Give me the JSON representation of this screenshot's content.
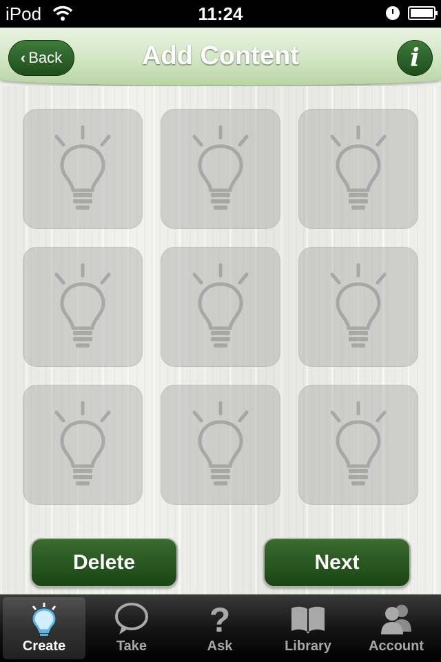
{
  "status_bar": {
    "carrier": "iPod",
    "time": "11:24"
  },
  "nav": {
    "back_label": "Back",
    "title": "Add Content",
    "info_label": "i"
  },
  "tiles": [
    {
      "icon": "lightbulb-icon"
    },
    {
      "icon": "lightbulb-icon"
    },
    {
      "icon": "lightbulb-icon"
    },
    {
      "icon": "lightbulb-icon"
    },
    {
      "icon": "lightbulb-icon"
    },
    {
      "icon": "lightbulb-icon"
    },
    {
      "icon": "lightbulb-icon"
    },
    {
      "icon": "lightbulb-icon"
    },
    {
      "icon": "lightbulb-icon"
    }
  ],
  "actions": {
    "delete_label": "Delete",
    "next_label": "Next"
  },
  "tabs": [
    {
      "label": "Create",
      "icon": "lightbulb-icon",
      "active": true
    },
    {
      "label": "Take",
      "icon": "speech-bubble-icon",
      "active": false
    },
    {
      "label": "Ask",
      "icon": "question-mark-icon",
      "active": false
    },
    {
      "label": "Library",
      "icon": "book-icon",
      "active": false
    },
    {
      "label": "Account",
      "icon": "people-icon",
      "active": false
    }
  ],
  "colors": {
    "accent_green": "#1e4e1c",
    "nav_green": "#d2e6c4",
    "active_icon": "#5ab4e6"
  }
}
